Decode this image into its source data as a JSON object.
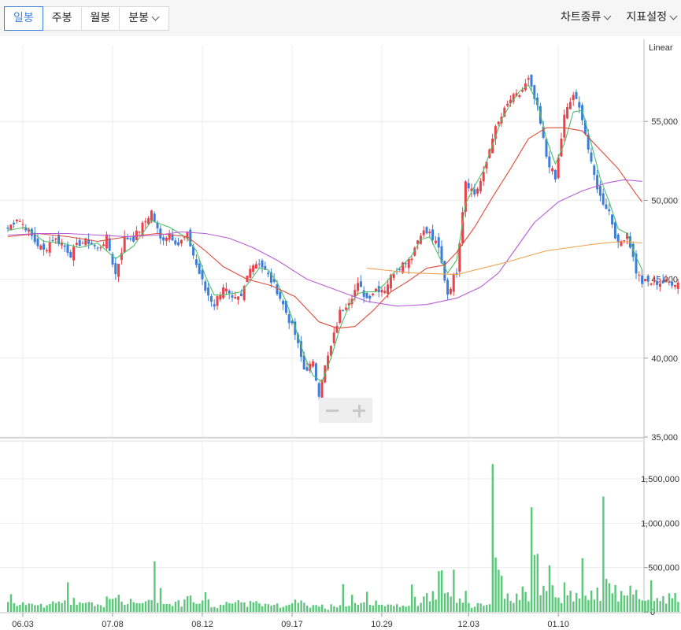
{
  "toolbar": {
    "tabs": [
      {
        "label": "일봉",
        "active": true
      },
      {
        "label": "주봉",
        "active": false
      },
      {
        "label": "월봉",
        "active": false
      },
      {
        "label": "분봉",
        "active": false
      }
    ],
    "chart_type_label": "차트종류",
    "indicator_label": "지표설정"
  },
  "zoom": {
    "minus_icon": "minus-icon",
    "plus_icon": "plus-icon"
  },
  "colors": {
    "up": "#e8424a",
    "down": "#3b7dd8",
    "ma5": "#4cc06a",
    "ma20": "#e04b3a",
    "ma60": "#b65ed6",
    "ma120": "#f0a050",
    "volume": "#5cc77a",
    "grid": "#ececec"
  },
  "chart_data": [
    {
      "type": "candlestick",
      "scale_label": "Linear",
      "yticks": [
        "35,000",
        "40,000",
        "45,000",
        "50,000",
        "55,000"
      ],
      "ylim": [
        35000,
        59800
      ],
      "xticks": [
        "06.03",
        "07.08",
        "08.12",
        "09.17",
        "10.29",
        "12.03",
        "01.10"
      ],
      "moving_averages": [
        "ma5",
        "ma20",
        "ma60",
        "ma120"
      ],
      "close_path": [
        [
          0,
          48200
        ],
        [
          3,
          48900
        ],
        [
          6,
          48300
        ],
        [
          9,
          47400
        ],
        [
          12,
          46800
        ],
        [
          15,
          47600
        ],
        [
          18,
          47300
        ],
        [
          21,
          46600
        ],
        [
          24,
          47300
        ],
        [
          27,
          47400
        ],
        [
          30,
          46900
        ],
        [
          33,
          47600
        ],
        [
          36,
          45300
        ],
        [
          39,
          47600
        ],
        [
          42,
          47600
        ],
        [
          45,
          48400
        ],
        [
          48,
          49300
        ],
        [
          51,
          47500
        ],
        [
          54,
          47900
        ],
        [
          57,
          47200
        ],
        [
          60,
          47800
        ],
        [
          63,
          45900
        ],
        [
          66,
          44300
        ],
        [
          69,
          43400
        ],
        [
          72,
          44600
        ],
        [
          75,
          43600
        ],
        [
          78,
          43800
        ],
        [
          81,
          45900
        ],
        [
          84,
          46100
        ],
        [
          87,
          45200
        ],
        [
          90,
          44300
        ],
        [
          93,
          42900
        ],
        [
          96,
          41500
        ],
        [
          99,
          39300
        ],
        [
          102,
          39600
        ],
        [
          104,
          37800
        ],
        [
          105,
          38800
        ],
        [
          108,
          40700
        ],
        [
          111,
          42900
        ],
        [
          114,
          43700
        ],
        [
          117,
          44600
        ],
        [
          120,
          43800
        ],
        [
          123,
          44400
        ],
        [
          126,
          44400
        ],
        [
          129,
          45500
        ],
        [
          132,
          46000
        ],
        [
          135,
          46500
        ],
        [
          138,
          48000
        ],
        [
          141,
          47900
        ],
        [
          144,
          46900
        ],
        [
          147,
          44100
        ],
        [
          150,
          45600
        ],
        [
          153,
          51300
        ],
        [
          156,
          50400
        ],
        [
          159,
          51600
        ],
        [
          162,
          54100
        ],
        [
          165,
          55300
        ],
        [
          168,
          56400
        ],
        [
          171,
          56700
        ],
        [
          174,
          57600
        ],
        [
          177,
          55800
        ],
        [
          180,
          52800
        ],
        [
          183,
          51300
        ],
        [
          186,
          55300
        ],
        [
          189,
          56700
        ],
        [
          192,
          55300
        ],
        [
          195,
          52200
        ],
        [
          198,
          50200
        ],
        [
          201,
          49300
        ],
        [
          204,
          47100
        ],
        [
          207,
          48000
        ],
        [
          210,
          45500
        ],
        [
          212,
          44800
        ]
      ],
      "ma5_path": [
        [
          0,
          48100
        ],
        [
          6,
          48300
        ],
        [
          12,
          47400
        ],
        [
          18,
          47300
        ],
        [
          24,
          47000
        ],
        [
          30,
          47300
        ],
        [
          36,
          46300
        ],
        [
          42,
          47100
        ],
        [
          48,
          48700
        ],
        [
          54,
          48300
        ],
        [
          60,
          47600
        ],
        [
          63,
          46800
        ],
        [
          66,
          45200
        ],
        [
          69,
          44000
        ],
        [
          72,
          44000
        ],
        [
          78,
          44200
        ],
        [
          81,
          44900
        ],
        [
          84,
          45700
        ],
        [
          87,
          45600
        ],
        [
          90,
          44800
        ],
        [
          93,
          43600
        ],
        [
          96,
          42000
        ],
        [
          99,
          40200
        ],
        [
          102,
          38900
        ],
        [
          105,
          38500
        ],
        [
          108,
          40000
        ],
        [
          111,
          41900
        ],
        [
          114,
          43300
        ],
        [
          117,
          44100
        ],
        [
          120,
          44200
        ],
        [
          123,
          44200
        ],
        [
          126,
          44700
        ],
        [
          129,
          45400
        ],
        [
          132,
          45900
        ],
        [
          135,
          46500
        ],
        [
          138,
          47500
        ],
        [
          141,
          47700
        ],
        [
          144,
          46500
        ],
        [
          147,
          45400
        ],
        [
          150,
          46200
        ],
        [
          153,
          49800
        ],
        [
          156,
          50900
        ],
        [
          159,
          51900
        ],
        [
          162,
          53500
        ],
        [
          165,
          55100
        ],
        [
          168,
          56100
        ],
        [
          171,
          56900
        ],
        [
          174,
          57300
        ],
        [
          177,
          56200
        ],
        [
          180,
          53900
        ],
        [
          183,
          52300
        ],
        [
          186,
          53600
        ],
        [
          189,
          55600
        ],
        [
          192,
          55700
        ],
        [
          195,
          53600
        ],
        [
          198,
          51400
        ],
        [
          201,
          49900
        ],
        [
          204,
          48200
        ],
        [
          207,
          47900
        ],
        [
          210,
          46400
        ],
        [
          212,
          45600
        ]
      ],
      "ma20_path": [
        [
          0,
          47700
        ],
        [
          10,
          47900
        ],
        [
          20,
          47700
        ],
        [
          30,
          47400
        ],
        [
          40,
          47700
        ],
        [
          50,
          47900
        ],
        [
          60,
          47700
        ],
        [
          66,
          46800
        ],
        [
          72,
          45800
        ],
        [
          80,
          45000
        ],
        [
          88,
          44600
        ],
        [
          96,
          43900
        ],
        [
          104,
          42300
        ],
        [
          110,
          41900
        ],
        [
          116,
          42000
        ],
        [
          122,
          43000
        ],
        [
          128,
          44200
        ],
        [
          134,
          44900
        ],
        [
          140,
          45700
        ],
        [
          146,
          45900
        ],
        [
          150,
          46700
        ],
        [
          156,
          48300
        ],
        [
          162,
          50200
        ],
        [
          168,
          52000
        ],
        [
          174,
          53900
        ],
        [
          180,
          54600
        ],
        [
          186,
          54600
        ],
        [
          192,
          54400
        ],
        [
          198,
          53200
        ],
        [
          204,
          52000
        ],
        [
          210,
          50400
        ],
        [
          212,
          49900
        ]
      ],
      "ma60_path": [
        [
          0,
          47800
        ],
        [
          10,
          47900
        ],
        [
          20,
          47900
        ],
        [
          30,
          47800
        ],
        [
          40,
          47700
        ],
        [
          50,
          47800
        ],
        [
          58,
          48000
        ],
        [
          66,
          47900
        ],
        [
          74,
          47600
        ],
        [
          82,
          47000
        ],
        [
          90,
          46200
        ],
        [
          100,
          45000
        ],
        [
          110,
          44300
        ],
        [
          120,
          43600
        ],
        [
          130,
          43300
        ],
        [
          140,
          43400
        ],
        [
          150,
          43800
        ],
        [
          158,
          44500
        ],
        [
          164,
          45400
        ],
        [
          170,
          47000
        ],
        [
          176,
          48600
        ],
        [
          184,
          49900
        ],
        [
          192,
          50600
        ],
        [
          200,
          51100
        ],
        [
          206,
          51300
        ],
        [
          212,
          51200
        ]
      ],
      "ma120_path": [
        [
          120,
          45700
        ],
        [
          135,
          45400
        ],
        [
          150,
          45300
        ],
        [
          165,
          46000
        ],
        [
          180,
          46800
        ],
        [
          195,
          47200
        ],
        [
          205,
          47400
        ],
        [
          212,
          47300
        ]
      ]
    },
    {
      "type": "bar",
      "series_name": "volume",
      "yticks": [
        "0",
        "500,000",
        "1,000,000",
        "1,500,000"
      ],
      "ylim": [
        0,
        1660000
      ],
      "values": [
        111000,
        200000,
        99000,
        67000,
        81000,
        108000,
        78000,
        96000,
        92000,
        76000,
        76000,
        91000,
        49000,
        75000,
        89000,
        119000,
        100000,
        117000,
        100000,
        130000,
        334000,
        79000,
        158000,
        80000,
        108000,
        98000,
        103000,
        111000,
        107000,
        66000,
        85000,
        76000,
        52000,
        174000,
        146000,
        146000,
        158000,
        193000,
        116000,
        80000,
        89000,
        148000,
        109000,
        98000,
        97000,
        100000,
        119000,
        136000,
        133000,
        570000,
        101000,
        269000,
        89000,
        90000,
        89000,
        67000,
        115000,
        131000,
        60000,
        140000,
        177000,
        184000,
        108000,
        91000,
        93000,
        129000,
        222000,
        140000,
        52000,
        56000,
        43000,
        81000,
        77000,
        113000,
        98000,
        94000,
        109000,
        132000,
        109000,
        107000,
        56000,
        123000,
        108000,
        121000,
        96000,
        64000,
        93000,
        87000,
        72000,
        81000,
        95000,
        47000,
        57000,
        72000,
        82000,
        97000,
        139000,
        102000,
        129000,
        103000,
        70000,
        48000,
        77000,
        78000,
        60000,
        83000,
        36000,
        24000,
        86000,
        63000,
        51000,
        75000,
        313000,
        62000,
        68000,
        193000,
        100000,
        80000,
        101000,
        108000,
        227000,
        80000,
        71000,
        128000,
        80000,
        81000,
        64000,
        84000,
        82000,
        67000,
        87000,
        55000,
        71000,
        60000,
        69000,
        309000,
        171000,
        67000,
        102000,
        174000,
        212000,
        119000,
        233000,
        138000,
        460000,
        468000,
        211000,
        220000,
        173000,
        476000,
        102000,
        152000,
        104000,
        237000,
        101000,
        45000,
        59000,
        100000,
        95000,
        69000,
        79000,
        86000,
        1667000,
        614000,
        475000,
        407000,
        148000,
        208000,
        124000,
        101000,
        207000,
        134000,
        286000,
        225000,
        121000,
        1179000,
        641000,
        654000,
        188000,
        295000,
        235000,
        525000,
        300000,
        165000,
        159000,
        100000,
        333000,
        187000,
        238000,
        119000,
        214000,
        151000,
        604000,
        183000,
        134000,
        240000,
        140000,
        274000,
        125000,
        1301000,
        372000,
        323000,
        209000,
        302000,
        118000,
        236000,
        185000,
        184000,
        297000,
        195000,
        249000,
        145000,
        130000,
        125000,
        134000,
        354000,
        123000,
        155000,
        122000,
        178000,
        93000,
        210000,
        154000,
        213000,
        112000
      ]
    }
  ]
}
